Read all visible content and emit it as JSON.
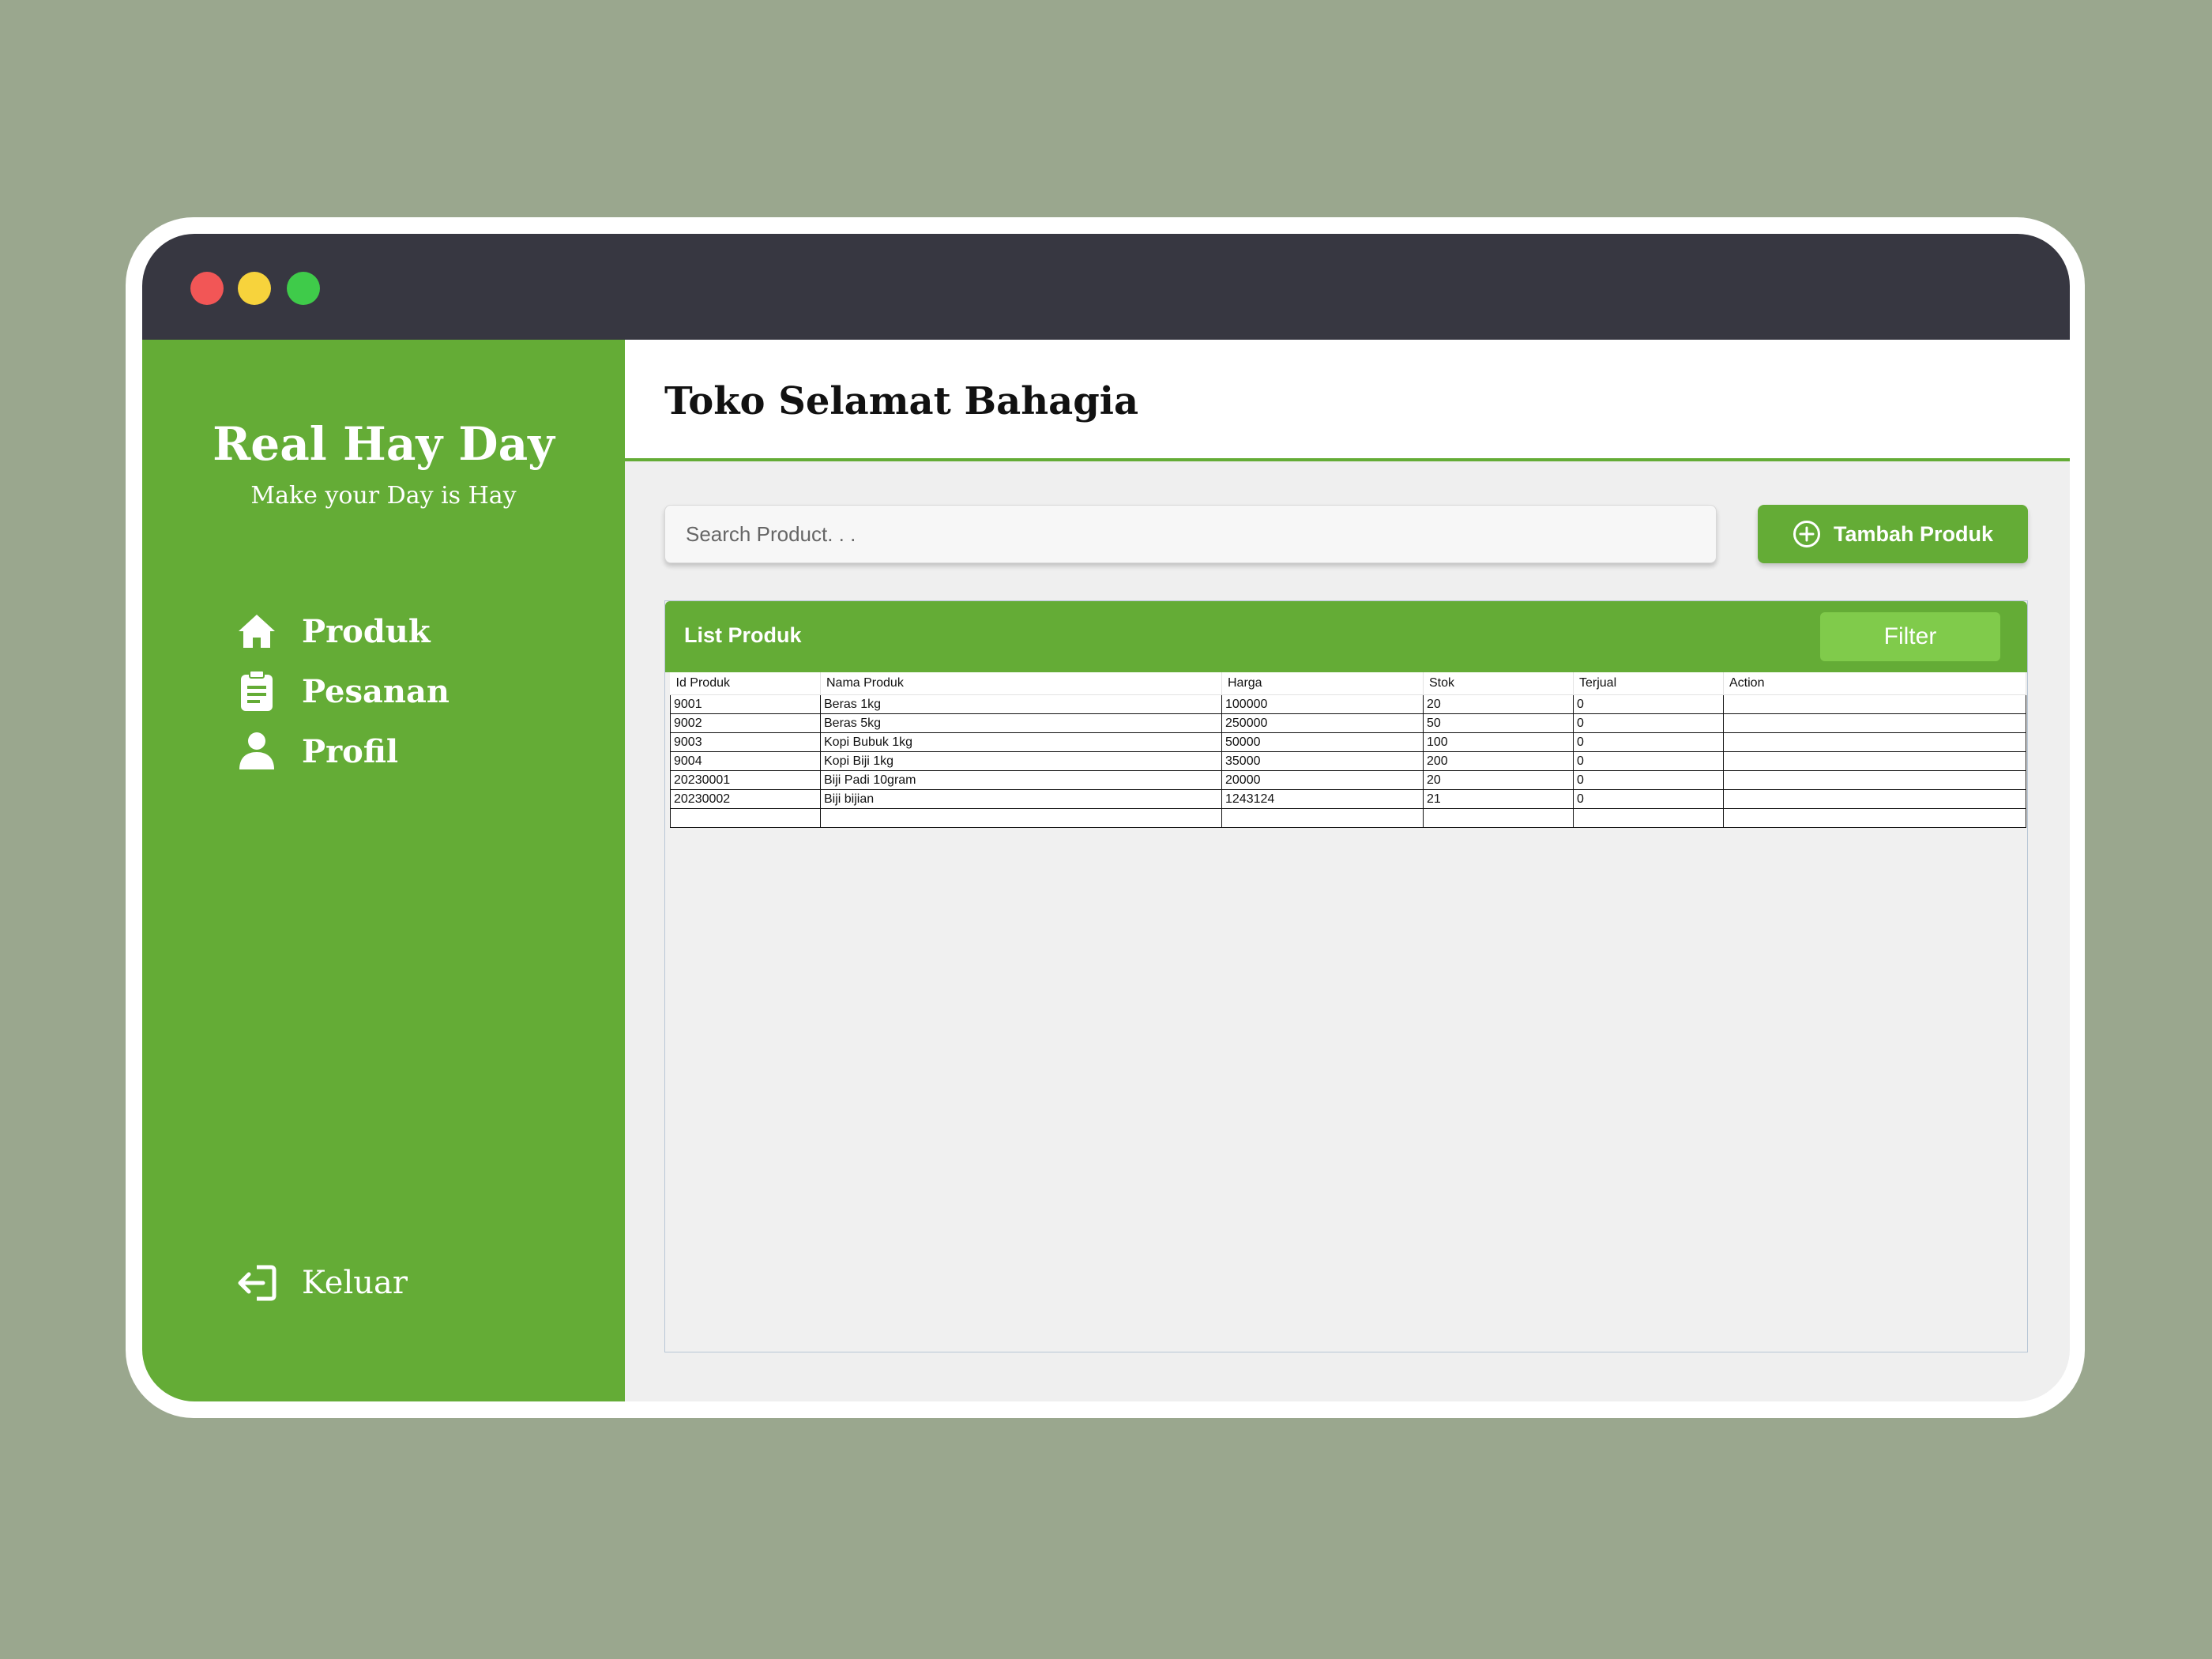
{
  "sidebar": {
    "brand_title": "Real Hay Day",
    "brand_subtitle": "Make your Day is Hay",
    "nav": [
      {
        "label": "Produk",
        "icon": "home-icon"
      },
      {
        "label": "Pesanan",
        "icon": "clipboard-icon"
      },
      {
        "label": "Profil",
        "icon": "user-icon"
      }
    ],
    "logout": {
      "label": "Keluar",
      "icon": "logout-icon"
    }
  },
  "header": {
    "title": "Toko Selamat Bahagia"
  },
  "search": {
    "placeholder": "Search Product. . ."
  },
  "add_button": {
    "label": "Tambah Produk",
    "icon": "plus-circle-icon"
  },
  "list": {
    "title": "List Produk",
    "filter_label": "Filter",
    "columns": [
      "Id Produk",
      "Nama Produk",
      "Harga",
      "Stok",
      "Terjual",
      "Action"
    ],
    "rows": [
      [
        "9001",
        "Beras 1kg",
        "100000",
        "20",
        "0",
        ""
      ],
      [
        "9002",
        "Beras 5kg",
        "250000",
        "50",
        "0",
        ""
      ],
      [
        "9003",
        "Kopi Bubuk 1kg",
        "50000",
        "100",
        "0",
        ""
      ],
      [
        "9004",
        "Kopi Biji 1kg",
        "35000",
        "200",
        "0",
        ""
      ],
      [
        "20230001",
        "Biji Padi 10gram",
        "20000",
        "20",
        "0",
        ""
      ],
      [
        "20230002",
        "Biji bijian",
        "1243124",
        "21",
        "0",
        ""
      ],
      [
        "",
        "",
        "",
        "",
        "",
        ""
      ]
    ]
  },
  "colors": {
    "accent_green": "#64ac36",
    "filter_green": "#80cb4b",
    "titlebar": "#373741",
    "background": "#9aa78e"
  }
}
